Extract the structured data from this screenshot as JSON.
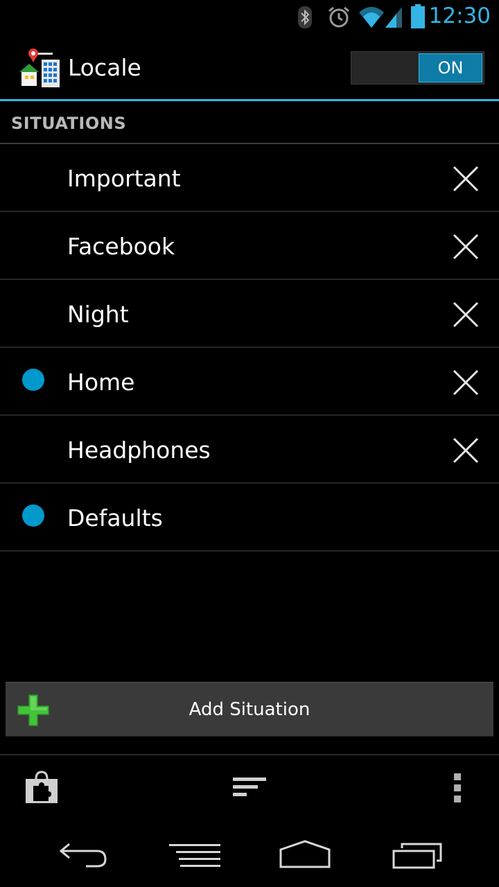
{
  "status_bar": {
    "time": "12:30",
    "icons": [
      "bluetooth-icon",
      "alarm-icon",
      "wifi-icon",
      "signal-icon",
      "battery-icon"
    ],
    "accent_color": "#33b5e5"
  },
  "action_bar": {
    "app_title": "Locale",
    "app_icon": "locale-app-icon",
    "toggle_label": "ON",
    "toggle_on": true
  },
  "section": {
    "header": "SITUATIONS"
  },
  "situations": [
    {
      "label": "Important",
      "active": false,
      "deletable": true
    },
    {
      "label": "Facebook",
      "active": false,
      "deletable": true
    },
    {
      "label": "Night",
      "active": false,
      "deletable": true
    },
    {
      "label": "Home",
      "active": true,
      "deletable": true
    },
    {
      "label": "Headphones",
      "active": false,
      "deletable": true
    },
    {
      "label": "Defaults",
      "active": true,
      "deletable": false
    }
  ],
  "add_button": {
    "label": "Add Situation",
    "icon": "green-plus-icon"
  },
  "bottom_actions": {
    "icons": [
      "plugin-store-icon",
      "sort-icon",
      "overflow-menu-icon"
    ]
  },
  "nav_bar": {
    "icons": [
      "back-icon",
      "menu-icon",
      "home-icon",
      "recent-apps-icon"
    ]
  },
  "colors": {
    "active_dot": "#0099cc",
    "toggle_on": "#0e7ca6"
  }
}
